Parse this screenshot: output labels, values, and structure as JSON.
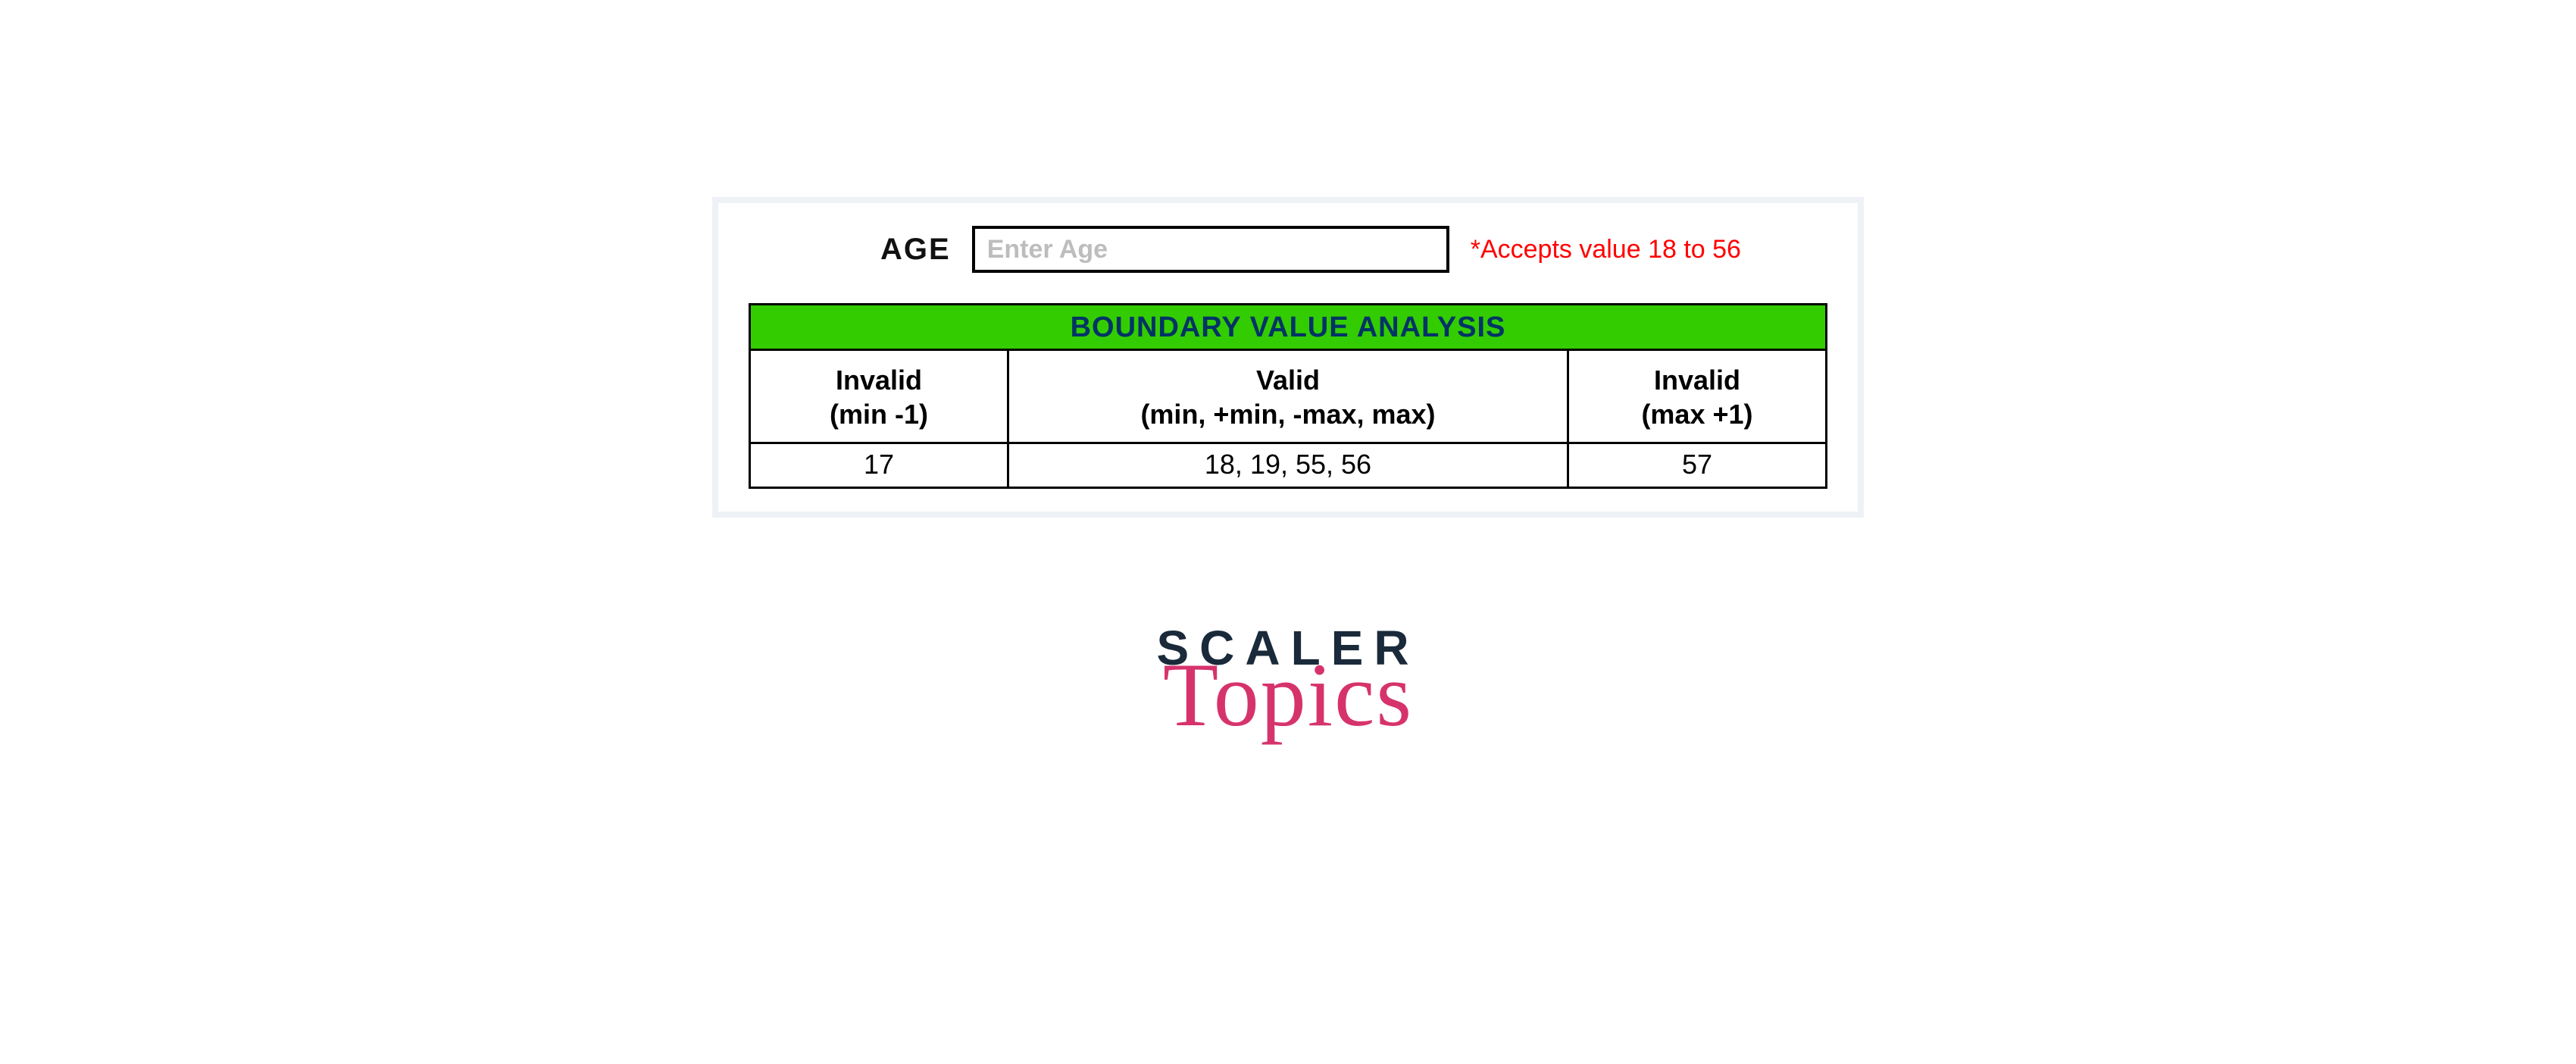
{
  "form": {
    "age_label": "AGE",
    "age_placeholder": "Enter Age",
    "hint": "*Accepts value 18 to 56"
  },
  "table": {
    "title": "BOUNDARY VALUE ANALYSIS",
    "cols": [
      {
        "h1": "Invalid",
        "h2": "(min -1)",
        "val": "17"
      },
      {
        "h1": "Valid",
        "h2": "(min, +min, -max, max)",
        "val": "18, 19, 55, 56"
      },
      {
        "h1": "Invalid",
        "h2": "(max +1)",
        "val": "57"
      }
    ]
  },
  "brand": {
    "line1": "SCALER",
    "line2": "Topics"
  },
  "chart_data": {
    "type": "table",
    "title": "BOUNDARY VALUE ANALYSIS",
    "columns": [
      "Invalid (min -1)",
      "Valid (min, +min, -max, max)",
      "Invalid (max +1)"
    ],
    "rows": [
      [
        "17",
        "18, 19, 55, 56",
        "57"
      ]
    ],
    "input_field": "AGE",
    "accepted_range": [
      18,
      56
    ]
  }
}
